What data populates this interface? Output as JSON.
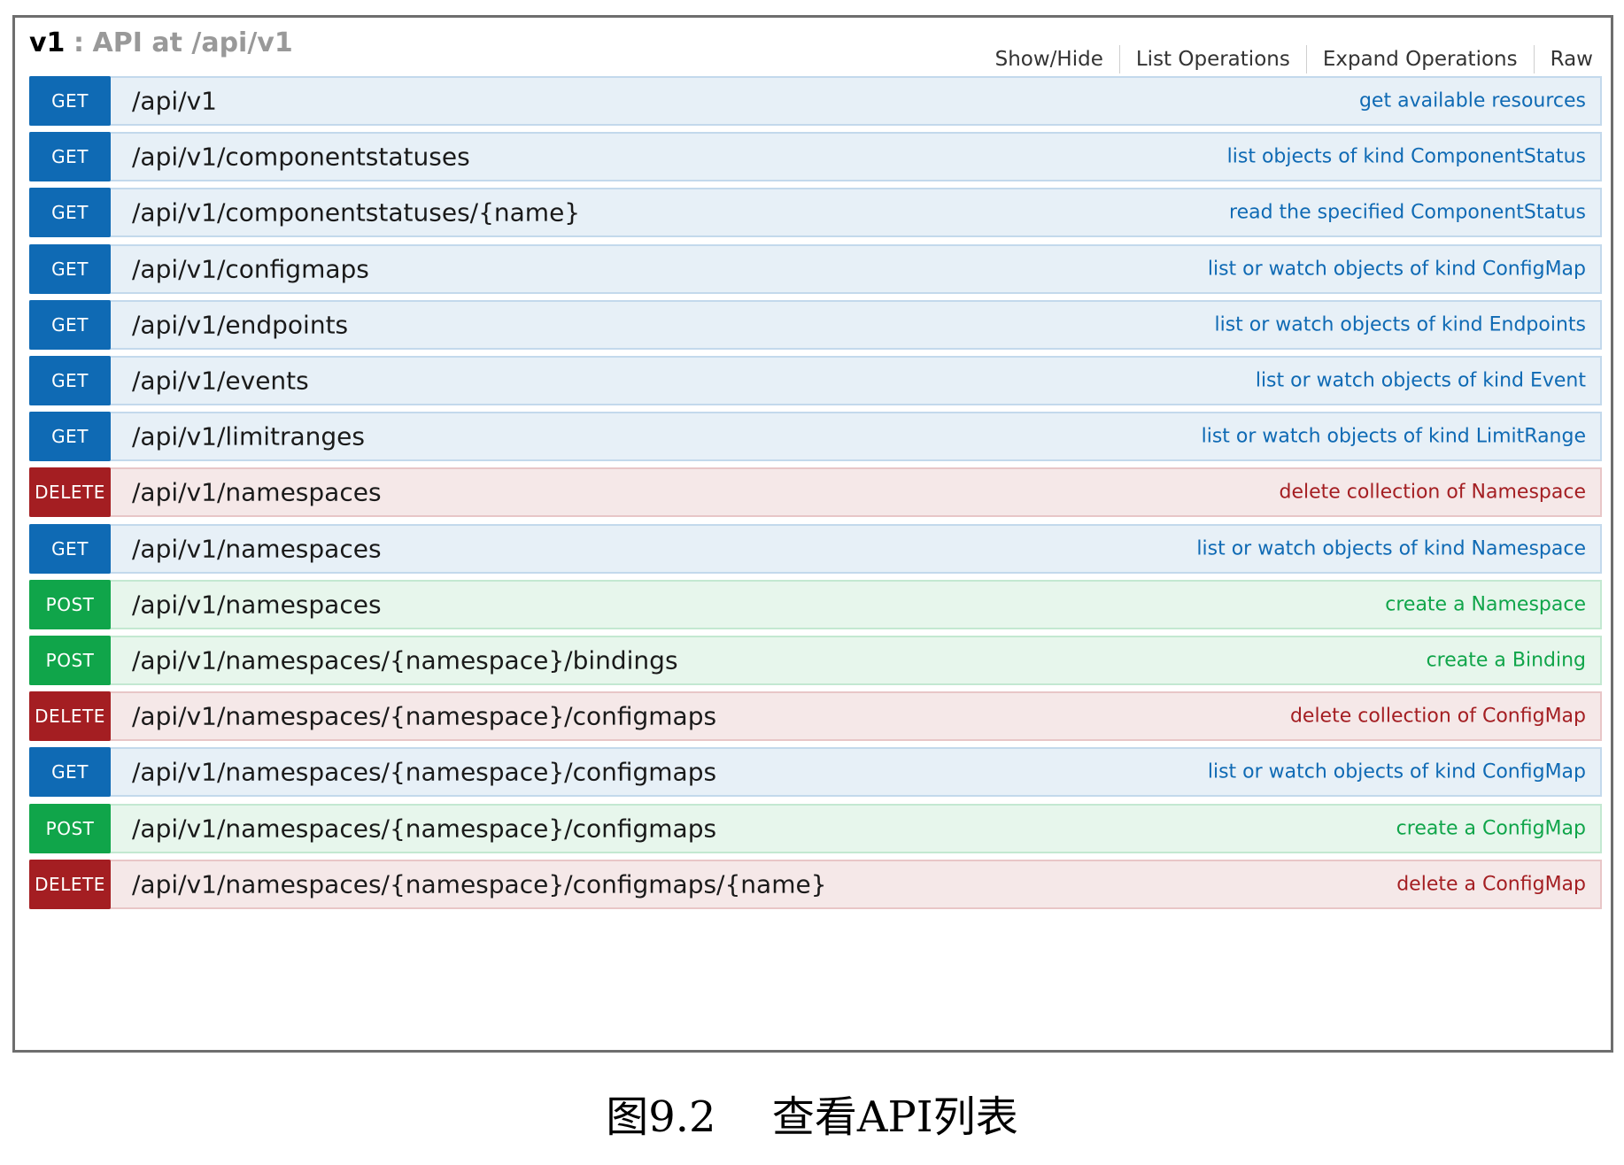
{
  "api": {
    "version": "v1",
    "separator": ":",
    "description": "API at /api/v1"
  },
  "header_actions": [
    "Show/Hide",
    "List Operations",
    "Expand Operations",
    "Raw"
  ],
  "method_colors": {
    "GET": "#0f6ab4",
    "DELETE": "#a41e22",
    "POST": "#10a54a"
  },
  "operations": [
    {
      "method": "GET",
      "path": "/api/v1",
      "summary": "get available resources"
    },
    {
      "method": "GET",
      "path": "/api/v1/componentstatuses",
      "summary": "list objects of kind ComponentStatus"
    },
    {
      "method": "GET",
      "path": "/api/v1/componentstatuses/{name}",
      "summary": "read the specified ComponentStatus"
    },
    {
      "method": "GET",
      "path": "/api/v1/configmaps",
      "summary": "list or watch objects of kind ConfigMap"
    },
    {
      "method": "GET",
      "path": "/api/v1/endpoints",
      "summary": "list or watch objects of kind Endpoints"
    },
    {
      "method": "GET",
      "path": "/api/v1/events",
      "summary": "list or watch objects of kind Event"
    },
    {
      "method": "GET",
      "path": "/api/v1/limitranges",
      "summary": "list or watch objects of kind LimitRange"
    },
    {
      "method": "DELETE",
      "path": "/api/v1/namespaces",
      "summary": "delete collection of Namespace"
    },
    {
      "method": "GET",
      "path": "/api/v1/namespaces",
      "summary": "list or watch objects of kind Namespace"
    },
    {
      "method": "POST",
      "path": "/api/v1/namespaces",
      "summary": "create a Namespace"
    },
    {
      "method": "POST",
      "path": "/api/v1/namespaces/{namespace}/bindings",
      "summary": "create a Binding"
    },
    {
      "method": "DELETE",
      "path": "/api/v1/namespaces/{namespace}/configmaps",
      "summary": "delete collection of ConfigMap"
    },
    {
      "method": "GET",
      "path": "/api/v1/namespaces/{namespace}/configmaps",
      "summary": "list or watch objects of kind ConfigMap"
    },
    {
      "method": "POST",
      "path": "/api/v1/namespaces/{namespace}/configmaps",
      "summary": "create a ConfigMap"
    },
    {
      "method": "DELETE",
      "path": "/api/v1/namespaces/{namespace}/configmaps/{name}",
      "summary": "delete a ConfigMap"
    }
  ],
  "caption": "图9.2　 查看API列表"
}
